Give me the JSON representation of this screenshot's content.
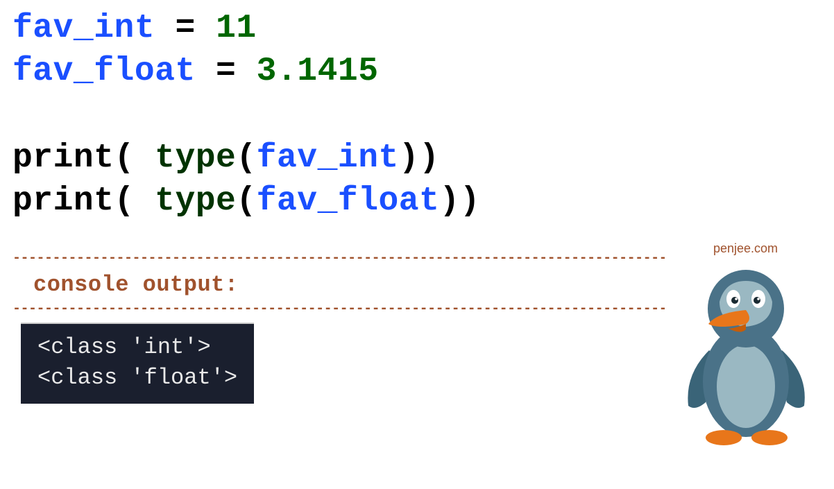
{
  "code": {
    "line1": {
      "var": "fav_int",
      "op": " = ",
      "val": "11"
    },
    "line2": {
      "var": "fav_float",
      "op": " = ",
      "val": "3.1415"
    },
    "line3": {
      "fn1": "print",
      "p1": "( ",
      "fn2": "type",
      "p2": "(",
      "arg": "fav_int",
      "p3": "))"
    },
    "line4": {
      "fn1": "print",
      "p1": "( ",
      "fn2": "type",
      "p2": "(",
      "arg": "fav_float",
      "p3": "))"
    }
  },
  "output": {
    "label": "console output:",
    "line1": "<class 'int'>",
    "line2": "<class 'float'>"
  },
  "mascot": {
    "label": "penjee.com"
  }
}
